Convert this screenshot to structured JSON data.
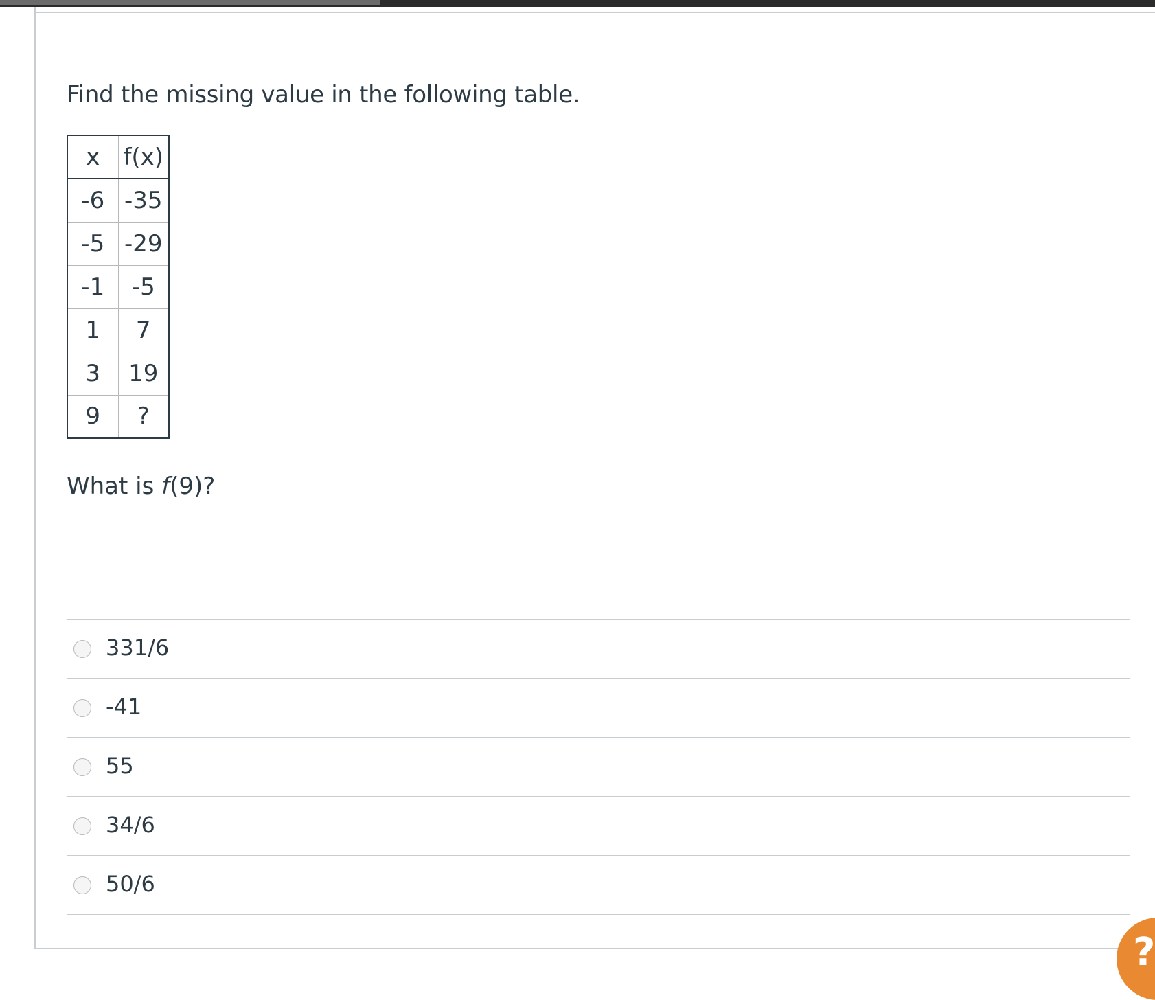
{
  "question": {
    "text": "Find the missing value in the following table."
  },
  "table": {
    "headers": [
      "x",
      "f(x)"
    ],
    "rows": [
      [
        "-6",
        "-35"
      ],
      [
        "-5",
        "-29"
      ],
      [
        "-1",
        "-5"
      ],
      [
        "1",
        "7"
      ],
      [
        "3",
        "19"
      ],
      [
        "9",
        "?"
      ]
    ]
  },
  "prompt": {
    "before": "What is ",
    "func": "f",
    "after": "(9)?"
  },
  "answers": [
    {
      "label": "331/6",
      "selected": false
    },
    {
      "label": "-41",
      "selected": false
    },
    {
      "label": "55",
      "selected": false
    },
    {
      "label": "34/6",
      "selected": false
    },
    {
      "label": "50/6",
      "selected": false
    }
  ],
  "help": {
    "icon": "question-mark-icon",
    "glyph": "?",
    "color": "#e98a33"
  }
}
